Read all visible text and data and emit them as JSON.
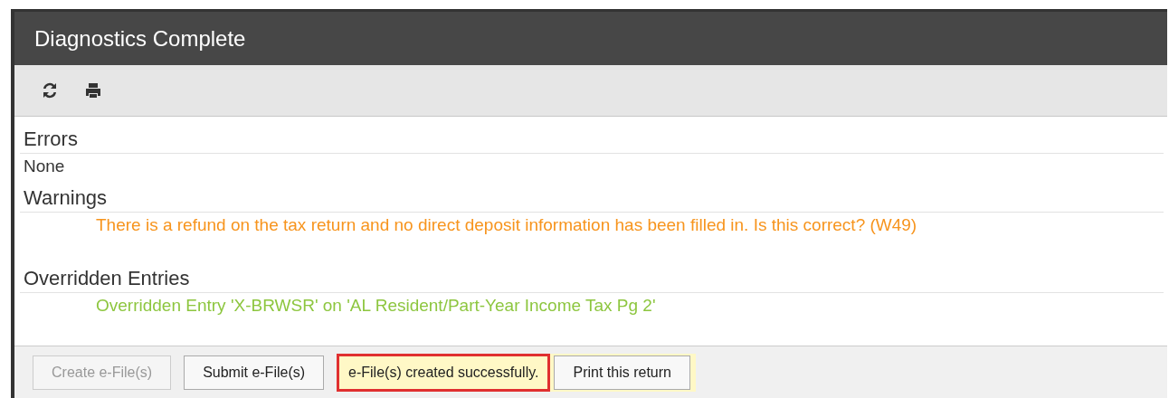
{
  "window": {
    "title": "Diagnostics Complete"
  },
  "toolbar": [
    {
      "kind": "refresh"
    },
    {
      "kind": "print"
    }
  ],
  "sections": [
    {
      "heading": "Errors",
      "kind": "plain",
      "items": [
        "None"
      ]
    },
    {
      "heading": "Warnings",
      "kind": "warning",
      "items": [
        "There is a refund on the tax return and no direct deposit information has been filled in. Is this correct? (W49)"
      ]
    },
    {
      "heading": "Overridden Entries",
      "kind": "override",
      "items": [
        "Overridden Entry 'X-BRWSR' on 'AL Resident/Part-Year Income Tax Pg 2'"
      ]
    }
  ],
  "footer": {
    "buttons": [
      {
        "label": "Create e-File(s)",
        "disabled": true
      },
      {
        "label": "Submit e-File(s)",
        "disabled": false
      }
    ],
    "message": "e-File(s) created successfully.",
    "print_button": "Print this return"
  }
}
